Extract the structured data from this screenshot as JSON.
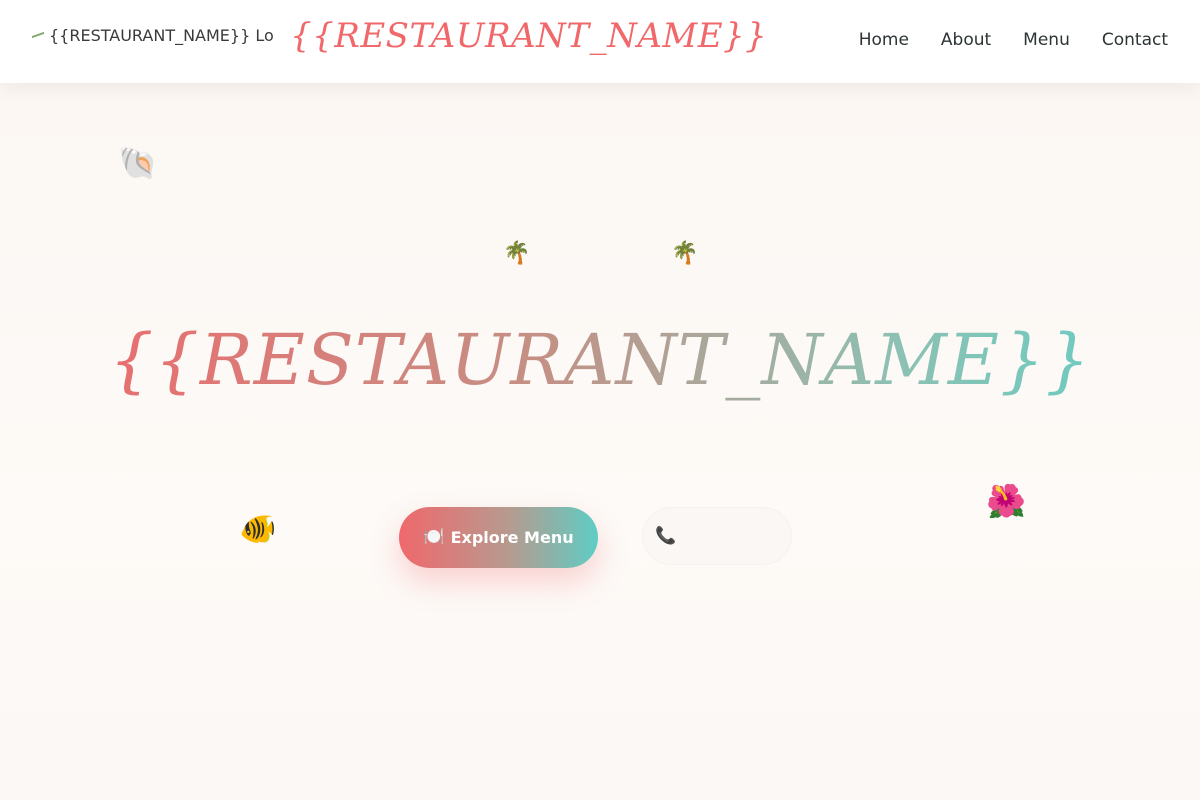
{
  "header": {
    "logo_alt": "{{RESTAURANT_NAME}} Logo",
    "brand_name": "{{RESTAURANT_NAME}}",
    "nav": [
      "Home",
      "About",
      "Menu",
      "Contact"
    ]
  },
  "hero": {
    "title": "{{RESTAURANT_NAME}}",
    "subtitle": "",
    "primary_button": {
      "icon": "🍽️",
      "label": "Explore Menu"
    },
    "secondary_button": {
      "icon": "📞",
      "label": ""
    },
    "decorations": {
      "shell": "🐚",
      "palm": "🌴",
      "fish": "🐠",
      "hibiscus": "🌺"
    }
  },
  "colors": {
    "brand": "#f0686a",
    "accent": "#5ecdc4",
    "background": "#fdf9f6",
    "text": "#2d3436"
  }
}
